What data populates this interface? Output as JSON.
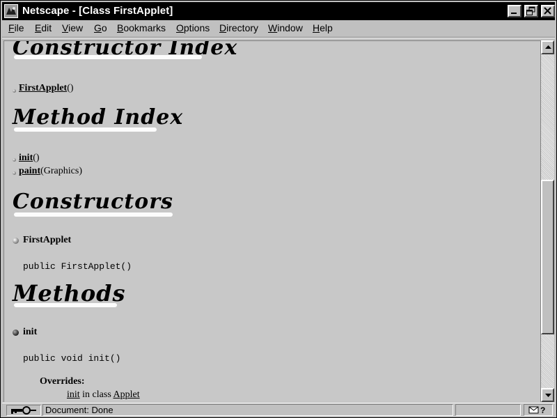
{
  "window": {
    "title": "Netscape - [Class FirstApplet]",
    "icon": "netscape-icon",
    "controls": [
      "minimize-icon",
      "maximize-icon",
      "close-icon"
    ]
  },
  "menu": {
    "items": [
      "File",
      "Edit",
      "View",
      "Go",
      "Bookmarks",
      "Options",
      "Directory",
      "Window",
      "Help"
    ],
    "mnemonics": [
      "F",
      "E",
      "V",
      "G",
      "B",
      "O",
      "D",
      "W",
      "H"
    ]
  },
  "content": {
    "constructor_index_heading": "Constructor Index",
    "constructor_index_items": [
      {
        "link": "FirstApplet",
        "suffix": "()"
      }
    ],
    "method_index_heading": "Method Index",
    "method_index_items": [
      {
        "link": "init",
        "suffix": "()"
      },
      {
        "link": "paint",
        "suffix": "(Graphics)"
      }
    ],
    "constructors_heading": "Constructors",
    "constructor_detail": {
      "name": "FirstApplet",
      "signature": "public FirstApplet()"
    },
    "methods_heading": "Methods",
    "method_detail": {
      "name": "init",
      "signature": "public void init()",
      "overrides_label": "Overrides:",
      "overrides_link": "init",
      "overrides_middle": " in class ",
      "overrides_class": "Applet"
    }
  },
  "status": {
    "text": "Document: Done",
    "progress": "",
    "mail_icon": "mail-icon",
    "security_icon": "key-icon"
  },
  "colors": {
    "titlebar": "#000000",
    "chrome": "#c0c0c0",
    "page_background": "#c8c8c8"
  }
}
